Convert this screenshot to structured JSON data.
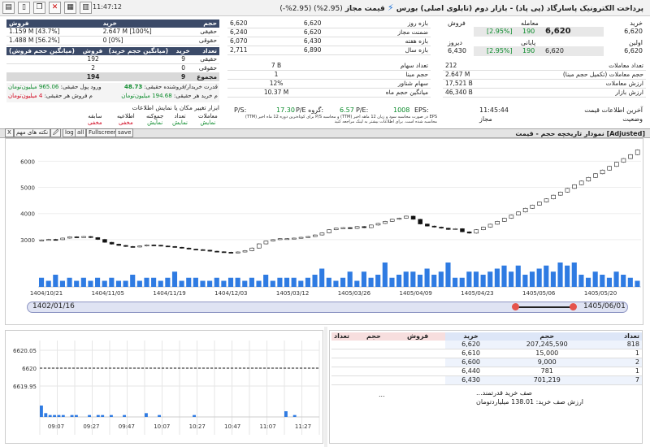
{
  "toolbar": {
    "clock": "11:47:12",
    "title": "پرداخت الکترونیک پاسارگاد (پی پاد) - بازار دوم (تابلوی اصلی) بورس",
    "sub": "قیمت مجاز",
    "pct": "(2.95%) (2.95%-)"
  },
  "left_summary": {
    "header": [
      "فروش",
      "",
      "خرید",
      "حجم"
    ],
    "rows": [
      [
        "1.159 M",
        "[43.7%]",
        "2.647 M",
        "[100%]",
        "حقیقی"
      ],
      [
        "1.488 M",
        "[56.2%]",
        "0",
        "[0%]",
        "حقوقی"
      ]
    ],
    "header2": [
      "(میانگین حجم فروش)",
      "فروش",
      "(میانگین حجم خرید)",
      "خرید",
      "تعداد"
    ],
    "rows2": [
      [
        "192",
        "9",
        "حقیقی"
      ],
      [
        "2",
        "0",
        "حقوقی"
      ],
      [
        "194",
        "9",
        "مجموع"
      ]
    ],
    "power_label": "قدرت خریدار/فروشنده حقیقی:",
    "power_value": "48.73",
    "inflow_label": "ورود پول حقیقی:",
    "inflow_value": "965.06 میلیون‌تومان",
    "avg_buy_label": "م خرید هر حقیقی:",
    "avg_buy_value": "194.68 میلیون‌تومان",
    "avg_sell_label": "م فروش هر حقیقی:",
    "avg_sell_value": "4 میلیون‌تومان",
    "tools_text": "ابزار تغییر مکان یا نمایش اطلاعات",
    "tools": [
      [
        "سابقه",
        "مخفی"
      ],
      [
        "اطلاعیه",
        "مخفی"
      ],
      [
        "جمع‌کنه",
        "نمایش"
      ],
      [
        "تعداد",
        "نمایش"
      ],
      [
        "معاملات",
        "نمایش"
      ]
    ]
  },
  "ranges": {
    "rows": [
      [
        "6,620",
        "6,620",
        "بازه روز"
      ],
      [
        "6,240",
        "6,620",
        "ضمنت مجاز"
      ],
      [
        "6,070",
        "6,430",
        "بازه هفته"
      ],
      [
        "2,711",
        "6,890",
        "بازه سال"
      ]
    ]
  },
  "price_box": {
    "buy_label": "خرید",
    "buy": "6,620",
    "sell_label": "فروش",
    "trade_label": "معامله",
    "trade": "6,620",
    "trade_chg": "190",
    "trade_pct": "[2.95%]",
    "first_label": "اولین",
    "first": "6,620",
    "last_label": "پایانی",
    "last": "6,620",
    "last_chg": "190",
    "last_pct": "[2.95%]",
    "yday_label": "دیروز",
    "yday": "6,430"
  },
  "stats": {
    "count_label": "تعداد معاملات",
    "count": "212",
    "volume_label": "حجم معاملات (تکمیل حجم مبنا)",
    "volume": "2.647 M",
    "value_label": "ارزش معاملات",
    "value": "17,521 B",
    "mcap_label": "ارزش بازار",
    "mcap": "46,340 B",
    "shares_label": "تعداد سهام",
    "shares": "7 B",
    "base_label": "حجم مبنا",
    "base": "1",
    "float_label": "سهام شناور",
    "float": "12%",
    "avgvol_label": "میانگین حجم ماه",
    "avgvol": "10.37 M",
    "update_label": "آخرین اطلاعات قیمت",
    "update": "11:45:44",
    "status_label": "وضعیت",
    "status": "مجاز",
    "eps_label": "EPS:",
    "eps": "1008",
    "pe_label": "P/E:",
    "pe": "6.57",
    "gpe_label": "P/E گروه:",
    "gpe": "17.30",
    "ps_label": "P/S:",
    "ps": "",
    "note1": "EPS در صورت محاسبه سود و زیان 12 ماهه اخیر (TTM) و محاسبه P/S برای کوتاه‌ترین دوره 12 ماه اخیر (TTM)",
    "note2": "محاسبه شده است. برای اطلاعات بیشتر به لینک مراجعه کنید"
  },
  "chart_toolbar": {
    "title": "نمودار تاریخچه حجم - قیمت [Adjusted]",
    "buttons": [
      "X",
      "نکته های مهم",
      "🖉",
      "log",
      "all",
      "Fullscreen",
      "save"
    ]
  },
  "chart_data": {
    "type": "candlestick",
    "x_ticks": [
      "1404/10/21",
      "1404/11/05",
      "1404/11/19",
      "1404/12/03",
      "1405/03/12",
      "1405/03/26",
      "1405/04/09",
      "1405/04/23",
      "1405/05/06",
      "1405/05/20"
    ],
    "y_ticks": [
      3000,
      4000,
      5000,
      6000
    ],
    "ylim": [
      2500,
      6600
    ],
    "close": [
      2990,
      3010,
      3000,
      3060,
      3110,
      3100,
      3120,
      3080,
      3010,
      2900,
      2830,
      2780,
      2740,
      2720,
      2760,
      2800,
      2790,
      2760,
      2740,
      2710,
      2680,
      2640,
      2620,
      2600,
      2560,
      2540,
      2520,
      2500,
      2530,
      2580,
      2680,
      2840,
      2950,
      3000,
      3040,
      3040,
      3060,
      3090,
      3120,
      3180,
      3260,
      3380,
      3440,
      3460,
      3430,
      3500,
      3460,
      3560,
      3620,
      3700,
      3780,
      3820,
      3900,
      3780,
      3600,
      3520,
      3480,
      3440,
      3390,
      3420,
      3300,
      3250,
      3380,
      3480,
      3590,
      3700,
      3820,
      3940,
      4060,
      4200,
      4320,
      4440,
      4560,
      4700,
      4820,
      4960,
      5100,
      5240,
      5380,
      5520,
      5660,
      5800,
      5960,
      6100,
      6250,
      6430
    ],
    "volume": [
      3,
      2,
      4,
      2,
      3,
      2,
      3,
      2,
      3,
      2,
      3,
      2,
      2,
      4,
      2,
      3,
      3,
      2,
      3,
      5,
      2,
      3,
      3,
      2,
      2,
      3,
      2,
      3,
      3,
      2,
      3,
      2,
      4,
      2,
      3,
      3,
      3,
      2,
      3,
      4,
      6,
      3,
      2,
      3,
      5,
      2,
      5,
      3,
      4,
      8,
      3,
      4,
      5,
      5,
      4,
      6,
      4,
      5,
      8,
      3,
      3,
      5,
      5,
      4,
      5,
      6,
      7,
      5,
      7,
      4,
      5,
      6,
      7,
      5,
      8,
      7,
      8,
      4,
      3,
      5,
      4,
      3,
      5,
      4,
      3,
      2
    ],
    "slider_start": "1402/01/16",
    "slider_end": "1405/06/01"
  },
  "intraday": {
    "y_ticks": [
      "6620.05",
      "6620",
      "6619.95"
    ],
    "x_ticks": [
      "09:07",
      "09:27",
      "09:47",
      "10:07",
      "10:27",
      "10:47",
      "11:07",
      "11:27"
    ],
    "volume": [
      6,
      2,
      1,
      1,
      1,
      1,
      0,
      1,
      1,
      0,
      0,
      1,
      0,
      1,
      1,
      0,
      1,
      0,
      0,
      1,
      0,
      0,
      0,
      0,
      2,
      0,
      0,
      1,
      0,
      0,
      0,
      0,
      0,
      0,
      0,
      1,
      0,
      0,
      0,
      0,
      0,
      0,
      0,
      0,
      0,
      0,
      0,
      0,
      0,
      0,
      0,
      0,
      0,
      0,
      0,
      0,
      3,
      0,
      1,
      0,
      0,
      0,
      0,
      0
    ]
  },
  "orderbook": {
    "headers": [
      "تعداد",
      "حجم",
      "خرید",
      "فروش",
      "حجم",
      "تعداد"
    ],
    "rows": [
      [
        "818",
        "207,245,590",
        "6,620",
        "",
        "",
        ""
      ],
      [
        "1",
        "15,000",
        "6,610",
        "",
        "",
        ""
      ],
      [
        "2",
        "9,000",
        "6,600",
        "",
        "",
        ""
      ],
      [
        "1",
        "781",
        "6,440",
        "",
        "",
        ""
      ],
      [
        "7",
        "701,219",
        "6,430",
        "",
        "",
        ""
      ]
    ],
    "queue_text": "صف خرید قدرتمند...",
    "queue_value": "ارزش صف خرید: 138.01 میلیاردتومان",
    "dots": "..."
  }
}
